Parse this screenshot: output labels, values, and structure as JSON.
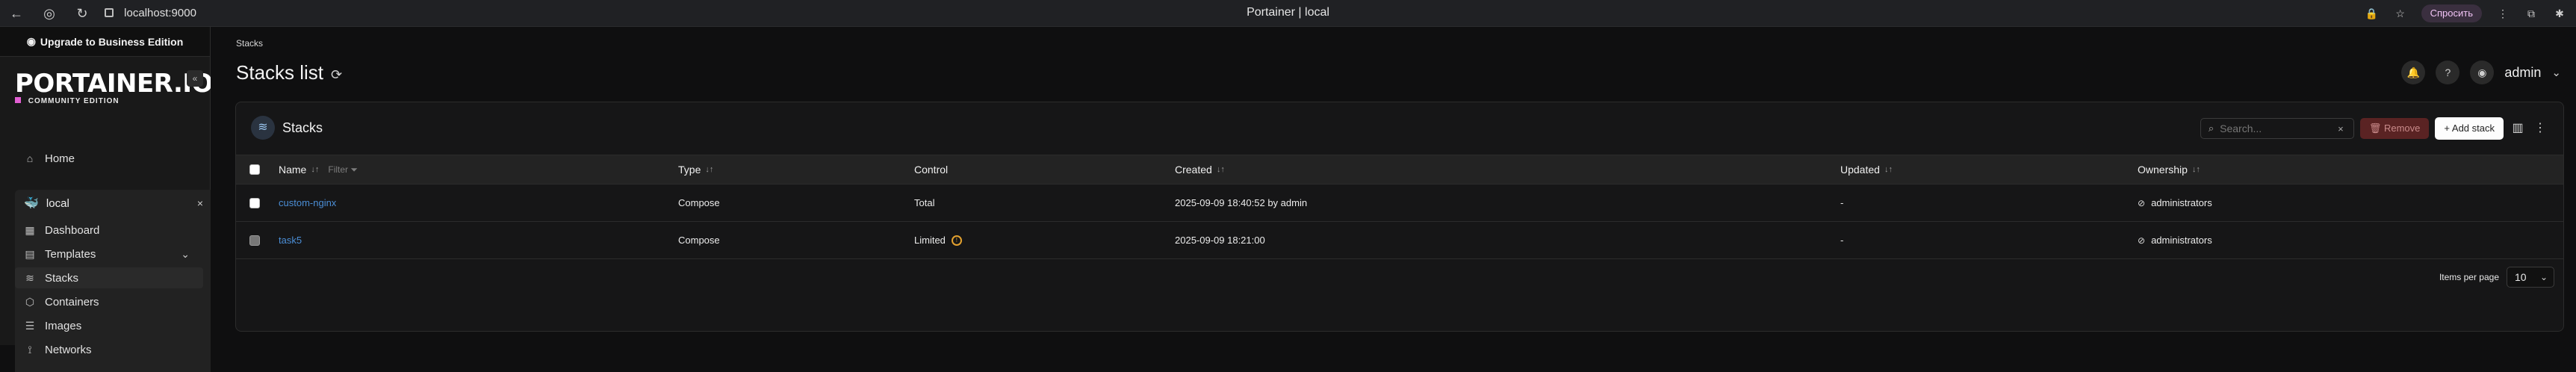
{
  "browser": {
    "url": "localhost:9000",
    "tab_title": "Portainer | local",
    "ask_label": "Спросить"
  },
  "sidebar": {
    "upgrade_label": "Upgrade to Business Edition",
    "brand": "PORTAINER.IO",
    "edition": "COMMUNITY EDITION",
    "collapse_label": "«",
    "home_label": "Home",
    "environment_name": "local",
    "items": [
      {
        "label": "Dashboard"
      },
      {
        "label": "Templates"
      },
      {
        "label": "Stacks"
      },
      {
        "label": "Containers"
      },
      {
        "label": "Images"
      },
      {
        "label": "Networks"
      }
    ]
  },
  "header": {
    "breadcrumb": "Stacks",
    "title": "Stacks list",
    "user": "admin"
  },
  "panel": {
    "title": "Stacks",
    "search_placeholder": "Search...",
    "remove_label": "Remove",
    "add_label": "Add stack"
  },
  "table": {
    "columns": [
      "Name",
      "Type",
      "Control",
      "Created",
      "Updated",
      "Ownership"
    ],
    "filter_label": "Filter",
    "rows": [
      {
        "name": "custom-nginx",
        "type": "Compose",
        "control": "Total",
        "created": "2025-09-09 18:40:52 by admin",
        "updated": "-",
        "ownership": "administrators"
      },
      {
        "name": "task5",
        "type": "Compose",
        "control": "Limited",
        "created": "2025-09-09 18:21:00",
        "updated": "-",
        "ownership": "administrators"
      }
    ]
  },
  "pagination": {
    "label": "Items per page",
    "value": "10"
  },
  "colors": {
    "accent": "#e25fd3",
    "link": "#4b8ed6",
    "warning": "#e3a12f",
    "danger": "#5a2323"
  }
}
